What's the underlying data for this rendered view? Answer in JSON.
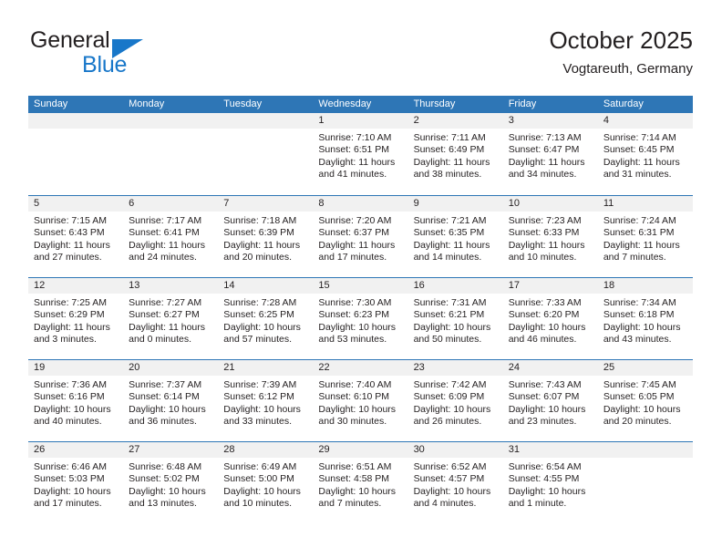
{
  "brand": {
    "name_part1": "General",
    "name_part2": "Blue",
    "logo_icon": "blue-triangle-icon",
    "color_dark": "#231f20",
    "color_blue": "#1877c9"
  },
  "header": {
    "title": "October 2025",
    "subtitle": "Vogtareuth, Germany"
  },
  "theme": {
    "header_blue": "#2e76b6",
    "band_gray": "#f1f1f1",
    "text": "#231f20"
  },
  "weekdays": [
    "Sunday",
    "Monday",
    "Tuesday",
    "Wednesday",
    "Thursday",
    "Friday",
    "Saturday"
  ],
  "labels": {
    "sunrise_prefix": "Sunrise:",
    "sunset_prefix": "Sunset:",
    "daylight_prefix": "Daylight:"
  },
  "weeks": [
    [
      {
        "day": "",
        "sunrise": "",
        "sunset": "",
        "daylight": "",
        "empty": true
      },
      {
        "day": "",
        "sunrise": "",
        "sunset": "",
        "daylight": "",
        "empty": true
      },
      {
        "day": "",
        "sunrise": "",
        "sunset": "",
        "daylight": "",
        "empty": true
      },
      {
        "day": "1",
        "sunrise": "Sunrise: 7:10 AM",
        "sunset": "Sunset: 6:51 PM",
        "daylight": "Daylight: 11 hours and 41 minutes."
      },
      {
        "day": "2",
        "sunrise": "Sunrise: 7:11 AM",
        "sunset": "Sunset: 6:49 PM",
        "daylight": "Daylight: 11 hours and 38 minutes."
      },
      {
        "day": "3",
        "sunrise": "Sunrise: 7:13 AM",
        "sunset": "Sunset: 6:47 PM",
        "daylight": "Daylight: 11 hours and 34 minutes."
      },
      {
        "day": "4",
        "sunrise": "Sunrise: 7:14 AM",
        "sunset": "Sunset: 6:45 PM",
        "daylight": "Daylight: 11 hours and 31 minutes."
      }
    ],
    [
      {
        "day": "5",
        "sunrise": "Sunrise: 7:15 AM",
        "sunset": "Sunset: 6:43 PM",
        "daylight": "Daylight: 11 hours and 27 minutes."
      },
      {
        "day": "6",
        "sunrise": "Sunrise: 7:17 AM",
        "sunset": "Sunset: 6:41 PM",
        "daylight": "Daylight: 11 hours and 24 minutes."
      },
      {
        "day": "7",
        "sunrise": "Sunrise: 7:18 AM",
        "sunset": "Sunset: 6:39 PM",
        "daylight": "Daylight: 11 hours and 20 minutes."
      },
      {
        "day": "8",
        "sunrise": "Sunrise: 7:20 AM",
        "sunset": "Sunset: 6:37 PM",
        "daylight": "Daylight: 11 hours and 17 minutes."
      },
      {
        "day": "9",
        "sunrise": "Sunrise: 7:21 AM",
        "sunset": "Sunset: 6:35 PM",
        "daylight": "Daylight: 11 hours and 14 minutes."
      },
      {
        "day": "10",
        "sunrise": "Sunrise: 7:23 AM",
        "sunset": "Sunset: 6:33 PM",
        "daylight": "Daylight: 11 hours and 10 minutes."
      },
      {
        "day": "11",
        "sunrise": "Sunrise: 7:24 AM",
        "sunset": "Sunset: 6:31 PM",
        "daylight": "Daylight: 11 hours and 7 minutes."
      }
    ],
    [
      {
        "day": "12",
        "sunrise": "Sunrise: 7:25 AM",
        "sunset": "Sunset: 6:29 PM",
        "daylight": "Daylight: 11 hours and 3 minutes."
      },
      {
        "day": "13",
        "sunrise": "Sunrise: 7:27 AM",
        "sunset": "Sunset: 6:27 PM",
        "daylight": "Daylight: 11 hours and 0 minutes."
      },
      {
        "day": "14",
        "sunrise": "Sunrise: 7:28 AM",
        "sunset": "Sunset: 6:25 PM",
        "daylight": "Daylight: 10 hours and 57 minutes."
      },
      {
        "day": "15",
        "sunrise": "Sunrise: 7:30 AM",
        "sunset": "Sunset: 6:23 PM",
        "daylight": "Daylight: 10 hours and 53 minutes."
      },
      {
        "day": "16",
        "sunrise": "Sunrise: 7:31 AM",
        "sunset": "Sunset: 6:21 PM",
        "daylight": "Daylight: 10 hours and 50 minutes."
      },
      {
        "day": "17",
        "sunrise": "Sunrise: 7:33 AM",
        "sunset": "Sunset: 6:20 PM",
        "daylight": "Daylight: 10 hours and 46 minutes."
      },
      {
        "day": "18",
        "sunrise": "Sunrise: 7:34 AM",
        "sunset": "Sunset: 6:18 PM",
        "daylight": "Daylight: 10 hours and 43 minutes."
      }
    ],
    [
      {
        "day": "19",
        "sunrise": "Sunrise: 7:36 AM",
        "sunset": "Sunset: 6:16 PM",
        "daylight": "Daylight: 10 hours and 40 minutes."
      },
      {
        "day": "20",
        "sunrise": "Sunrise: 7:37 AM",
        "sunset": "Sunset: 6:14 PM",
        "daylight": "Daylight: 10 hours and 36 minutes."
      },
      {
        "day": "21",
        "sunrise": "Sunrise: 7:39 AM",
        "sunset": "Sunset: 6:12 PM",
        "daylight": "Daylight: 10 hours and 33 minutes."
      },
      {
        "day": "22",
        "sunrise": "Sunrise: 7:40 AM",
        "sunset": "Sunset: 6:10 PM",
        "daylight": "Daylight: 10 hours and 30 minutes."
      },
      {
        "day": "23",
        "sunrise": "Sunrise: 7:42 AM",
        "sunset": "Sunset: 6:09 PM",
        "daylight": "Daylight: 10 hours and 26 minutes."
      },
      {
        "day": "24",
        "sunrise": "Sunrise: 7:43 AM",
        "sunset": "Sunset: 6:07 PM",
        "daylight": "Daylight: 10 hours and 23 minutes."
      },
      {
        "day": "25",
        "sunrise": "Sunrise: 7:45 AM",
        "sunset": "Sunset: 6:05 PM",
        "daylight": "Daylight: 10 hours and 20 minutes."
      }
    ],
    [
      {
        "day": "26",
        "sunrise": "Sunrise: 6:46 AM",
        "sunset": "Sunset: 5:03 PM",
        "daylight": "Daylight: 10 hours and 17 minutes."
      },
      {
        "day": "27",
        "sunrise": "Sunrise: 6:48 AM",
        "sunset": "Sunset: 5:02 PM",
        "daylight": "Daylight: 10 hours and 13 minutes."
      },
      {
        "day": "28",
        "sunrise": "Sunrise: 6:49 AM",
        "sunset": "Sunset: 5:00 PM",
        "daylight": "Daylight: 10 hours and 10 minutes."
      },
      {
        "day": "29",
        "sunrise": "Sunrise: 6:51 AM",
        "sunset": "Sunset: 4:58 PM",
        "daylight": "Daylight: 10 hours and 7 minutes."
      },
      {
        "day": "30",
        "sunrise": "Sunrise: 6:52 AM",
        "sunset": "Sunset: 4:57 PM",
        "daylight": "Daylight: 10 hours and 4 minutes."
      },
      {
        "day": "31",
        "sunrise": "Sunrise: 6:54 AM",
        "sunset": "Sunset: 4:55 PM",
        "daylight": "Daylight: 10 hours and 1 minute."
      },
      {
        "day": "",
        "sunrise": "",
        "sunset": "",
        "daylight": "",
        "empty": true
      }
    ]
  ]
}
